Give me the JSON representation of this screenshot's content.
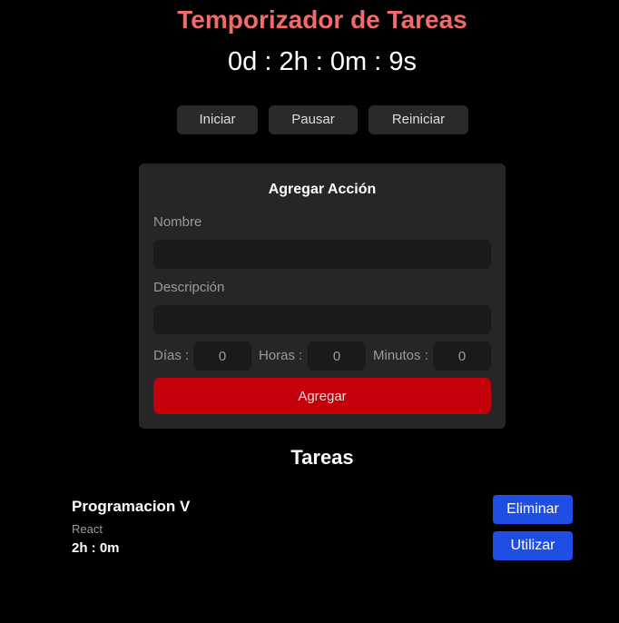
{
  "header": {
    "title": "Temporizador de Tareas",
    "clock": "0d : 2h : 0m : 9s"
  },
  "controls": {
    "start_label": "Iniciar",
    "pause_label": "Pausar",
    "reset_label": "Reiniciar"
  },
  "form": {
    "title": "Agregar Acción",
    "name_label": "Nombre",
    "name_value": "",
    "description_label": "Descripción",
    "description_value": "",
    "days_label": "Días :",
    "days_value": "0",
    "hours_label": "Horas :",
    "hours_value": "0",
    "minutes_label": "Minutos :",
    "minutes_value": "0",
    "submit_label": "Agregar"
  },
  "tasks": {
    "heading": "Tareas",
    "items": [
      {
        "name": "Programacion V",
        "description": "React",
        "time": "2h : 0m",
        "delete_label": "Eliminar",
        "use_label": "Utilizar"
      }
    ]
  },
  "colors": {
    "title": "#f26b6b",
    "submit_button": "#c4000b",
    "action_buttons": "#1f4ee5",
    "card": "#262626"
  }
}
